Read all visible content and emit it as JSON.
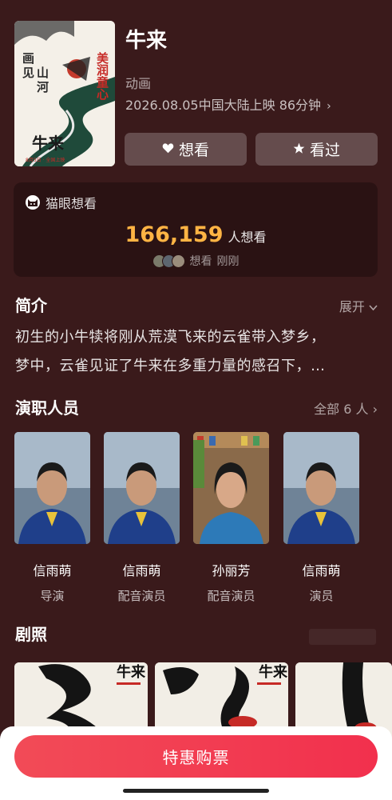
{
  "movie": {
    "title": "牛来",
    "genre": "动画",
    "release": "2026.08.05中国大陆上映 86分钟",
    "release_arrow": "›",
    "poster": {
      "title_text": "牛来",
      "side_text": "画见山河",
      "top_text": "美润童心",
      "date_text": "8月5日 · 全国上映"
    }
  },
  "actions": {
    "want_label": "想看",
    "want_icon": "heart-icon",
    "seen_label": "看过",
    "seen_icon": "star-icon"
  },
  "want_card": {
    "source": "猫眼想看",
    "count": "166,159",
    "count_suffix": "人想看",
    "recent_label": "想看",
    "recent_time": "刚刚"
  },
  "intro": {
    "title": "简介",
    "expand": "展开",
    "lines": [
      "初生的小牛犊将刚从荒漠飞来的云雀带入梦乡，",
      "梦中，云雀见证了牛来在多重力量的感召下，…"
    ]
  },
  "cast": {
    "title": "演职人员",
    "all": "全部 6 人",
    "members": [
      {
        "name": "信雨萌",
        "role": "导演"
      },
      {
        "name": "信雨萌",
        "role": "配音演员"
      },
      {
        "name": "孙丽芳",
        "role": "配音演员"
      },
      {
        "name": "信雨萌",
        "role": "演员"
      }
    ]
  },
  "stills": {
    "title": "剧照",
    "poster_label": "牛来"
  },
  "buy": {
    "label": "特惠购票"
  },
  "colors": {
    "background": "#3a1a1b",
    "count": "#ffb444",
    "buy": "#f2304d"
  }
}
